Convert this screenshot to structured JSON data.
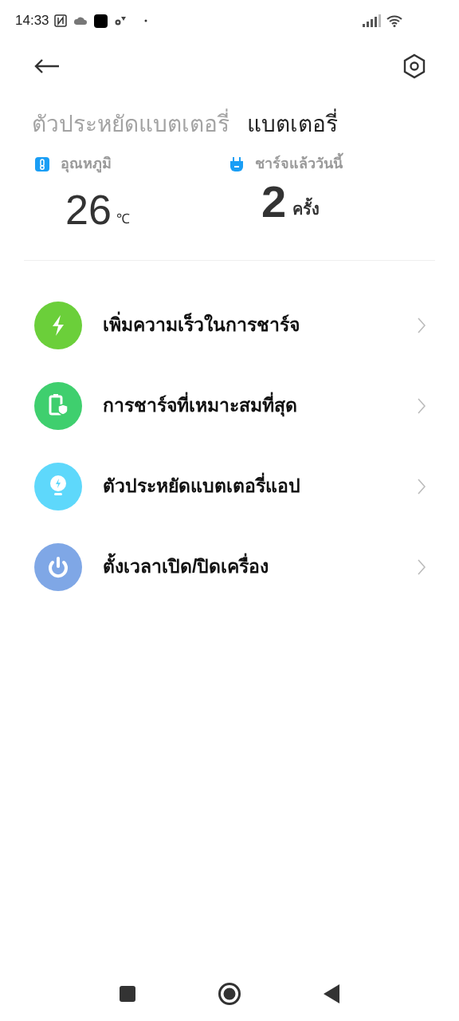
{
  "status_bar": {
    "time": "14:33"
  },
  "tabs": [
    {
      "label": "ตัวประหยัดแบตเตอรี่",
      "selected": false
    },
    {
      "label": "แบตเตอรี่",
      "selected": true
    }
  ],
  "stats": [
    {
      "kind": "temperature",
      "label": "อุณหภูมิ",
      "value": "26",
      "unit": "℃"
    },
    {
      "kind": "charges",
      "label": "ชาร์จแล้ววันนี้",
      "value": "2",
      "unit": "ครั้ง"
    }
  ],
  "menu": [
    {
      "kind": "bolt",
      "label": "เพิ่มความเร็วในการชาร์จ",
      "color": "#6bcf3a"
    },
    {
      "kind": "battery-shield",
      "label": "การชาร์จที่เหมาะสมที่สุด",
      "color": "#3fcf6e"
    },
    {
      "kind": "bulb",
      "label": "ตัวประหยัดแบตเตอรี่แอป",
      "color": "#5ed8fb"
    },
    {
      "kind": "power",
      "label": "ตั้งเวลาเปิด/ปิดเครื่อง",
      "color": "#7fa7e6"
    }
  ]
}
